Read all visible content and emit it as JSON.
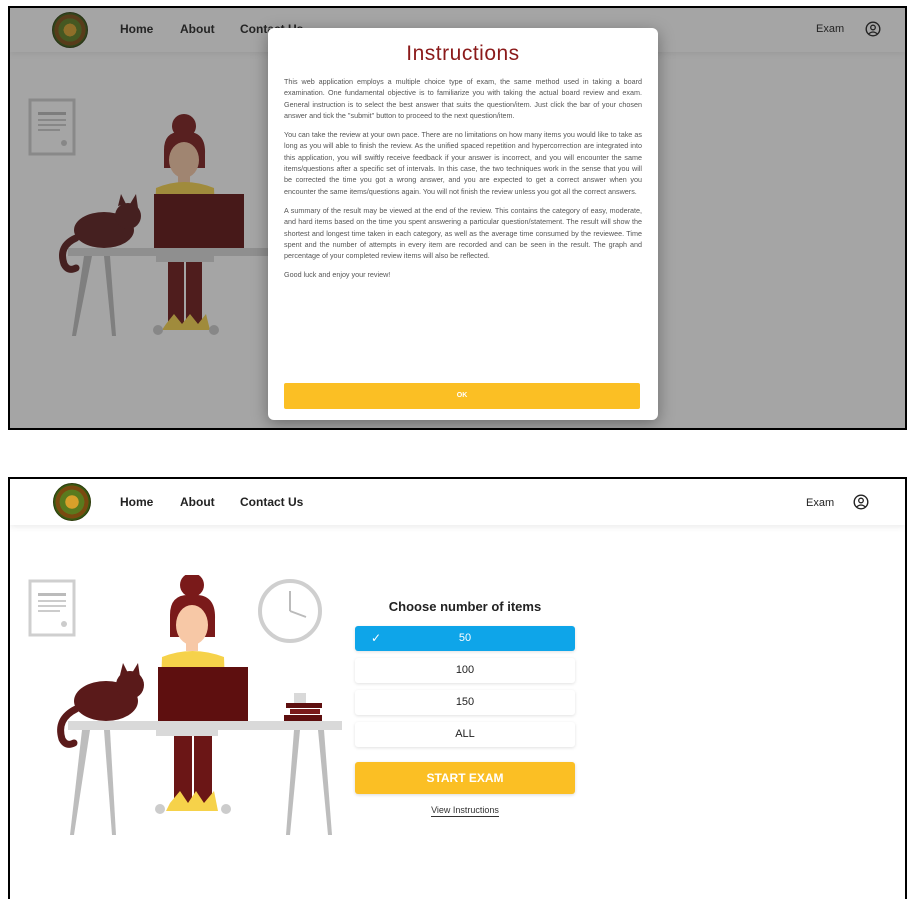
{
  "nav": {
    "home": "Home",
    "about": "About",
    "contact": "Contact Us",
    "exam": "Exam",
    "logo_icon": "seal-logo-icon",
    "user_icon": "user-circle-icon"
  },
  "modal": {
    "title": "Instructions",
    "paragraphs": [
      "This web application employs a multiple choice type of exam, the same method used in taking a board examination. One fundamental objective is to familiarize you with taking the actual board review and exam. General instruction is to select the best answer that suits the question/item. Just click the bar of your chosen answer and tick the \"submit\" button to proceed to the next question/item.",
      "You can take the review at your own pace. There are no limitations on how many items you would like to take as long as you will able to finish the review. As the unified spaced repetition and hypercorrection are integrated into this application, you will swiftly receive feedback if your answer is incorrect, and you will encounter the same items/questions after a specific set of intervals. In this case, the two techniques work in the sense that you will be corrected the time you got a wrong answer, and you are expected to get a correct answer when you encounter the same items/questions again. You will not finish the review unless you got all the correct answers.",
      "A summary of the result may be viewed at the end of the review. This contains the category of easy, moderate, and hard items based on the time you spent answering a particular question/statement. The result will show the shortest and longest time taken in each category, as well as the average time consumed by the reviewee. Time spent and the number of attempts in every item are recorded and can be seen in the result. The graph and percentage of your completed review items will also be reflected.",
      "Good luck and enjoy your review!"
    ],
    "ok_label": "OK"
  },
  "exam_panel": {
    "title": "Choose number of items",
    "options": [
      "50",
      "100",
      "150",
      "ALL"
    ],
    "selected": "50",
    "start_label": "START EXAM",
    "view_instructions": "View Instructions"
  },
  "colors": {
    "accent_yellow": "#fbbf24",
    "selected_blue": "#0ea5e9",
    "title_red": "#8b1a1a",
    "hair": "#7a1a1a",
    "clothes": "#6b1616",
    "cat": "#5a1a1a",
    "skin": "#f7c8a6",
    "shirt": "#f6d24a"
  }
}
